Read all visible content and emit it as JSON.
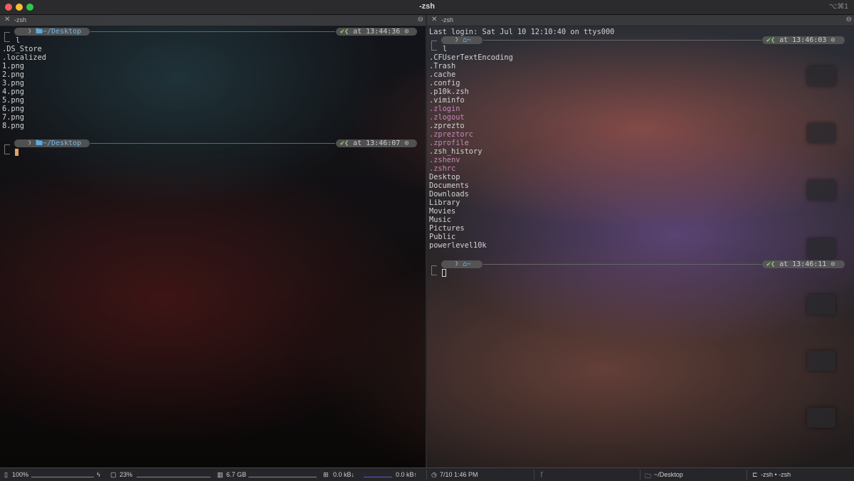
{
  "window": {
    "title": "-zsh",
    "shortcut": "⌥⌘1"
  },
  "left_pane": {
    "tab_label": "-zsh",
    "prompts": [
      {
        "path": "~/Desktop",
        "status": "at 13:44:36",
        "command": "l"
      },
      {
        "path": "~/Desktop",
        "status": "at 13:46:07",
        "command": ""
      }
    ],
    "listing": [
      ".DS_Store",
      ".localized",
      "1.png",
      "2.png",
      "3.png",
      "4.png",
      "5.png",
      "6.png",
      "7.png",
      "8.png"
    ]
  },
  "right_pane": {
    "tab_label": "-zsh",
    "last_login": "Last login: Sat Jul 10 12:10:40 on ttys000",
    "prompts": [
      {
        "path": "~",
        "status": "at 13:46:03",
        "command": "l"
      },
      {
        "path": "~",
        "status": "at 13:46:11",
        "command": ""
      }
    ],
    "listing": [
      {
        "name": ".CFUserTextEncoding",
        "style": "plain"
      },
      {
        "name": ".Trash",
        "style": "plain"
      },
      {
        "name": ".cache",
        "style": "plain"
      },
      {
        "name": ".config",
        "style": "plain"
      },
      {
        "name": ".p10k.zsh",
        "style": "plain"
      },
      {
        "name": ".viminfo",
        "style": "plain"
      },
      {
        "name": ".zlogin",
        "style": "pink"
      },
      {
        "name": ".zlogout",
        "style": "pink"
      },
      {
        "name": ".zprezto",
        "style": "plain"
      },
      {
        "name": ".zpreztorc",
        "style": "pink"
      },
      {
        "name": ".zprofile",
        "style": "pink"
      },
      {
        "name": ".zsh_history",
        "style": "plain"
      },
      {
        "name": ".zshenv",
        "style": "pink"
      },
      {
        "name": ".zshrc",
        "style": "pink"
      },
      {
        "name": "Desktop",
        "style": "plain"
      },
      {
        "name": "Documents",
        "style": "plain"
      },
      {
        "name": "Downloads",
        "style": "plain"
      },
      {
        "name": "Library",
        "style": "plain"
      },
      {
        "name": "Movies",
        "style": "plain"
      },
      {
        "name": "Music",
        "style": "plain"
      },
      {
        "name": "Pictures",
        "style": "plain"
      },
      {
        "name": "Public",
        "style": "plain"
      },
      {
        "name": "powerlevel10k",
        "style": "plain"
      }
    ]
  },
  "status_bar": {
    "battery": "100%",
    "cpu": "23%",
    "memory": "6.7 GB",
    "net_down": "0.0 kB↓",
    "net_up": "0.0 kB↑",
    "clock": "7/10 1:46 PM",
    "cwd": "~/Desktop",
    "session": "-zsh • -zsh"
  },
  "icons": [
    "apple-icon",
    "folder-icon",
    "home-icon",
    "check-icon",
    "clock-icon",
    "battery-icon",
    "cpu-icon",
    "memory-icon",
    "network-icon",
    "git-branch-icon"
  ],
  "colors": {
    "folder_blue": "#6cb8ea",
    "check_green": "#8fd16a",
    "dotfile_pink": "#c489b4",
    "cursor_left": "#e8a35a",
    "cursor_right": "#d8d8d8"
  }
}
